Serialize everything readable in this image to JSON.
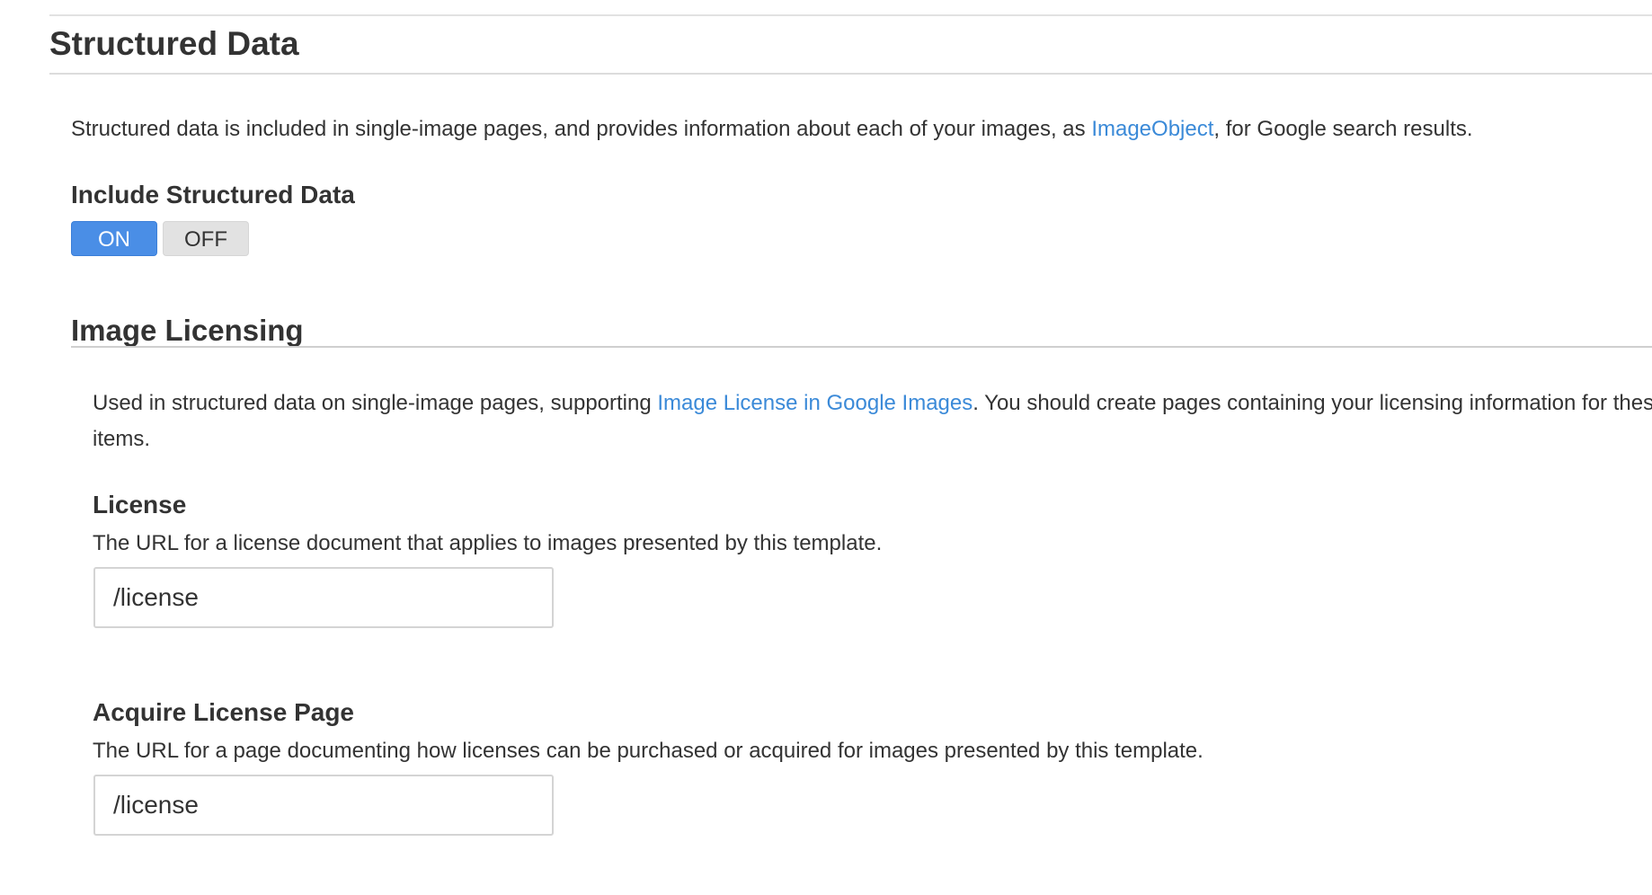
{
  "structured_data": {
    "title": "Structured Data",
    "description_before": "Structured data is included in single-image pages, and provides information about each of your images, as ",
    "description_link": "ImageObject",
    "description_after": ", for Google search results.",
    "include_label": "Include Structured Data",
    "toggle": {
      "on_label": "ON",
      "off_label": "OFF",
      "selected": "ON"
    }
  },
  "image_licensing": {
    "title": "Image Licensing",
    "description_before": "Used in structured data on single-image pages, supporting ",
    "description_link": "Image License in Google Images",
    "description_after": ". You should create pages containing your licensing information for these items.",
    "license": {
      "label": "License",
      "help": "The URL for a license document that applies to images presented by this template.",
      "value": "/license"
    },
    "acquire_license_page": {
      "label": "Acquire License Page",
      "help": "The URL for a page documenting how licenses can be purchased or acquired for images presented by this template.",
      "value": "/license"
    }
  },
  "colors": {
    "accent": "#4a8ee6",
    "link": "#3b8ad8",
    "text": "#333333"
  }
}
